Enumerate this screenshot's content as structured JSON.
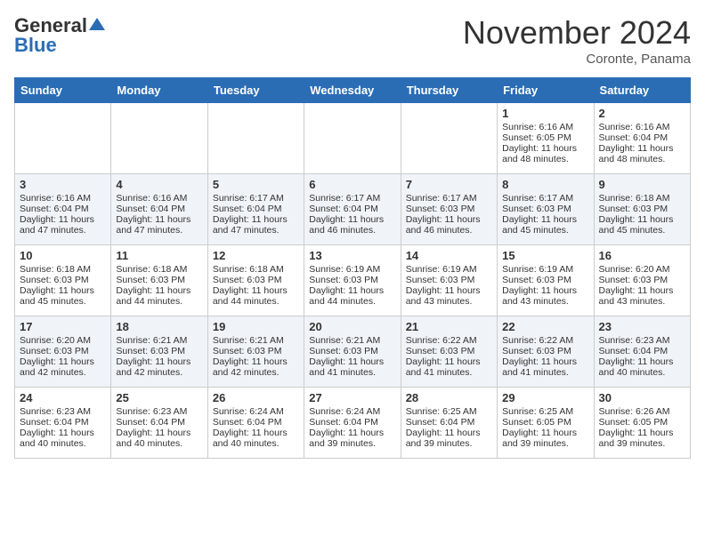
{
  "header": {
    "logo_general": "General",
    "logo_blue": "Blue",
    "month_title": "November 2024",
    "location": "Coronte, Panama"
  },
  "days_of_week": [
    "Sunday",
    "Monday",
    "Tuesday",
    "Wednesday",
    "Thursday",
    "Friday",
    "Saturday"
  ],
  "weeks": [
    [
      {
        "day": "",
        "sunrise": "",
        "sunset": "",
        "daylight": ""
      },
      {
        "day": "",
        "sunrise": "",
        "sunset": "",
        "daylight": ""
      },
      {
        "day": "",
        "sunrise": "",
        "sunset": "",
        "daylight": ""
      },
      {
        "day": "",
        "sunrise": "",
        "sunset": "",
        "daylight": ""
      },
      {
        "day": "",
        "sunrise": "",
        "sunset": "",
        "daylight": ""
      },
      {
        "day": "1",
        "sunrise": "Sunrise: 6:16 AM",
        "sunset": "Sunset: 6:05 PM",
        "daylight": "Daylight: 11 hours and 48 minutes."
      },
      {
        "day": "2",
        "sunrise": "Sunrise: 6:16 AM",
        "sunset": "Sunset: 6:04 PM",
        "daylight": "Daylight: 11 hours and 48 minutes."
      }
    ],
    [
      {
        "day": "3",
        "sunrise": "Sunrise: 6:16 AM",
        "sunset": "Sunset: 6:04 PM",
        "daylight": "Daylight: 11 hours and 47 minutes."
      },
      {
        "day": "4",
        "sunrise": "Sunrise: 6:16 AM",
        "sunset": "Sunset: 6:04 PM",
        "daylight": "Daylight: 11 hours and 47 minutes."
      },
      {
        "day": "5",
        "sunrise": "Sunrise: 6:17 AM",
        "sunset": "Sunset: 6:04 PM",
        "daylight": "Daylight: 11 hours and 47 minutes."
      },
      {
        "day": "6",
        "sunrise": "Sunrise: 6:17 AM",
        "sunset": "Sunset: 6:04 PM",
        "daylight": "Daylight: 11 hours and 46 minutes."
      },
      {
        "day": "7",
        "sunrise": "Sunrise: 6:17 AM",
        "sunset": "Sunset: 6:03 PM",
        "daylight": "Daylight: 11 hours and 46 minutes."
      },
      {
        "day": "8",
        "sunrise": "Sunrise: 6:17 AM",
        "sunset": "Sunset: 6:03 PM",
        "daylight": "Daylight: 11 hours and 45 minutes."
      },
      {
        "day": "9",
        "sunrise": "Sunrise: 6:18 AM",
        "sunset": "Sunset: 6:03 PM",
        "daylight": "Daylight: 11 hours and 45 minutes."
      }
    ],
    [
      {
        "day": "10",
        "sunrise": "Sunrise: 6:18 AM",
        "sunset": "Sunset: 6:03 PM",
        "daylight": "Daylight: 11 hours and 45 minutes."
      },
      {
        "day": "11",
        "sunrise": "Sunrise: 6:18 AM",
        "sunset": "Sunset: 6:03 PM",
        "daylight": "Daylight: 11 hours and 44 minutes."
      },
      {
        "day": "12",
        "sunrise": "Sunrise: 6:18 AM",
        "sunset": "Sunset: 6:03 PM",
        "daylight": "Daylight: 11 hours and 44 minutes."
      },
      {
        "day": "13",
        "sunrise": "Sunrise: 6:19 AM",
        "sunset": "Sunset: 6:03 PM",
        "daylight": "Daylight: 11 hours and 44 minutes."
      },
      {
        "day": "14",
        "sunrise": "Sunrise: 6:19 AM",
        "sunset": "Sunset: 6:03 PM",
        "daylight": "Daylight: 11 hours and 43 minutes."
      },
      {
        "day": "15",
        "sunrise": "Sunrise: 6:19 AM",
        "sunset": "Sunset: 6:03 PM",
        "daylight": "Daylight: 11 hours and 43 minutes."
      },
      {
        "day": "16",
        "sunrise": "Sunrise: 6:20 AM",
        "sunset": "Sunset: 6:03 PM",
        "daylight": "Daylight: 11 hours and 43 minutes."
      }
    ],
    [
      {
        "day": "17",
        "sunrise": "Sunrise: 6:20 AM",
        "sunset": "Sunset: 6:03 PM",
        "daylight": "Daylight: 11 hours and 42 minutes."
      },
      {
        "day": "18",
        "sunrise": "Sunrise: 6:21 AM",
        "sunset": "Sunset: 6:03 PM",
        "daylight": "Daylight: 11 hours and 42 minutes."
      },
      {
        "day": "19",
        "sunrise": "Sunrise: 6:21 AM",
        "sunset": "Sunset: 6:03 PM",
        "daylight": "Daylight: 11 hours and 42 minutes."
      },
      {
        "day": "20",
        "sunrise": "Sunrise: 6:21 AM",
        "sunset": "Sunset: 6:03 PM",
        "daylight": "Daylight: 11 hours and 41 minutes."
      },
      {
        "day": "21",
        "sunrise": "Sunrise: 6:22 AM",
        "sunset": "Sunset: 6:03 PM",
        "daylight": "Daylight: 11 hours and 41 minutes."
      },
      {
        "day": "22",
        "sunrise": "Sunrise: 6:22 AM",
        "sunset": "Sunset: 6:03 PM",
        "daylight": "Daylight: 11 hours and 41 minutes."
      },
      {
        "day": "23",
        "sunrise": "Sunrise: 6:23 AM",
        "sunset": "Sunset: 6:04 PM",
        "daylight": "Daylight: 11 hours and 40 minutes."
      }
    ],
    [
      {
        "day": "24",
        "sunrise": "Sunrise: 6:23 AM",
        "sunset": "Sunset: 6:04 PM",
        "daylight": "Daylight: 11 hours and 40 minutes."
      },
      {
        "day": "25",
        "sunrise": "Sunrise: 6:23 AM",
        "sunset": "Sunset: 6:04 PM",
        "daylight": "Daylight: 11 hours and 40 minutes."
      },
      {
        "day": "26",
        "sunrise": "Sunrise: 6:24 AM",
        "sunset": "Sunset: 6:04 PM",
        "daylight": "Daylight: 11 hours and 40 minutes."
      },
      {
        "day": "27",
        "sunrise": "Sunrise: 6:24 AM",
        "sunset": "Sunset: 6:04 PM",
        "daylight": "Daylight: 11 hours and 39 minutes."
      },
      {
        "day": "28",
        "sunrise": "Sunrise: 6:25 AM",
        "sunset": "Sunset: 6:04 PM",
        "daylight": "Daylight: 11 hours and 39 minutes."
      },
      {
        "day": "29",
        "sunrise": "Sunrise: 6:25 AM",
        "sunset": "Sunset: 6:05 PM",
        "daylight": "Daylight: 11 hours and 39 minutes."
      },
      {
        "day": "30",
        "sunrise": "Sunrise: 6:26 AM",
        "sunset": "Sunset: 6:05 PM",
        "daylight": "Daylight: 11 hours and 39 minutes."
      }
    ]
  ]
}
